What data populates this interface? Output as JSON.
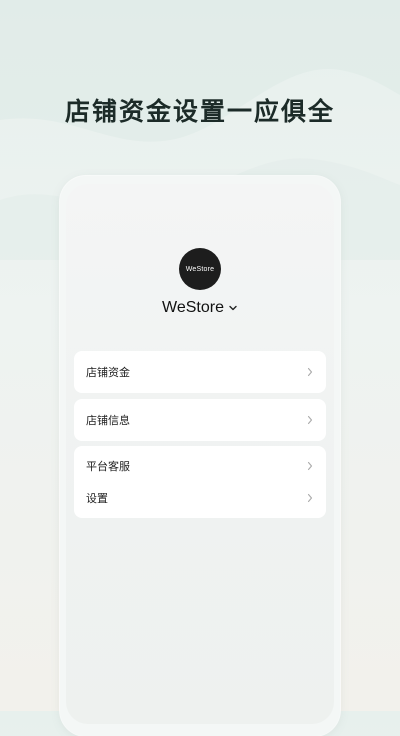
{
  "headline": "店铺资金设置一应俱全",
  "store": {
    "avatar_text": "WeStore",
    "name": "WeStore"
  },
  "menu": {
    "group1": [
      {
        "label": "店铺资金"
      }
    ],
    "group2": [
      {
        "label": "店铺信息"
      }
    ],
    "group3": [
      {
        "label": "平台客服"
      },
      {
        "label": "设置"
      }
    ]
  },
  "colors": {
    "background_top": "#e7f0ed",
    "background_bottom": "#f2f1ec",
    "card": "#ffffff",
    "avatar": "#1d1d1d",
    "headline_text": "#1c2b28"
  },
  "icons": {
    "store_dropdown": "chevron-down-icon",
    "row_arrow": "chevron-right-icon"
  }
}
